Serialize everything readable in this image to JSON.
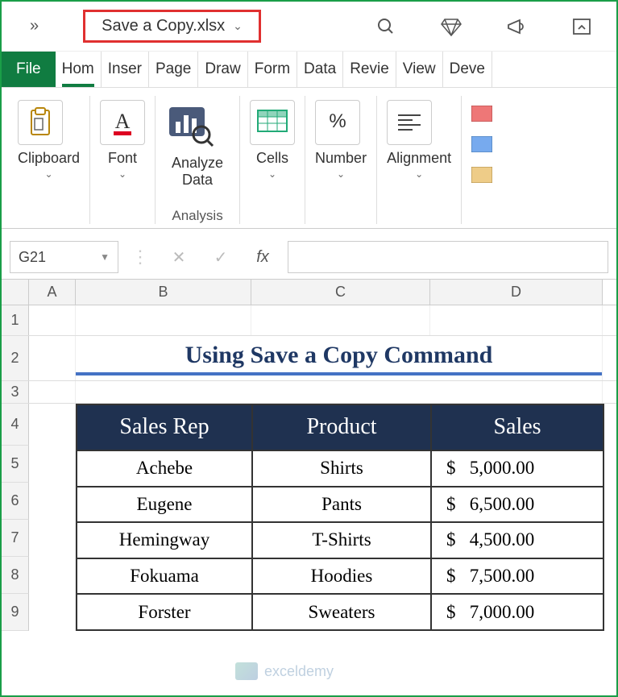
{
  "titlebar": {
    "filename": "Save a Copy.xlsx",
    "qat_more": "»"
  },
  "tabs": {
    "file": "File",
    "items": [
      "Hom",
      "Inser",
      "Page",
      "Draw",
      "Form",
      "Data",
      "Revie",
      "View",
      "Deve"
    ],
    "active": 0
  },
  "ribbon": {
    "clipboard": "Clipboard",
    "font": "Font",
    "analyze": "Analyze Data",
    "analysis_group": "Analysis",
    "cells": "Cells",
    "number": "Number",
    "alignment": "Alignment"
  },
  "formula_bar": {
    "namebox": "G21",
    "fx": "fx"
  },
  "columns": [
    "A",
    "B",
    "C",
    "D"
  ],
  "row_numbers": [
    "1",
    "2",
    "3",
    "4",
    "5",
    "6",
    "7",
    "8",
    "9"
  ],
  "sheet": {
    "title": "Using Save a Copy Command",
    "headers": [
      "Sales Rep",
      "Product",
      "Sales"
    ],
    "rows": [
      {
        "rep": "Achebe",
        "product": "Shirts",
        "sales": "$   5,000.00"
      },
      {
        "rep": "Eugene",
        "product": "Pants",
        "sales": "$   6,500.00"
      },
      {
        "rep": "Hemingway",
        "product": "T-Shirts",
        "sales": "$   4,500.00"
      },
      {
        "rep": "Fokuama",
        "product": "Hoodies",
        "sales": "$   7,500.00"
      },
      {
        "rep": "Forster",
        "product": "Sweaters",
        "sales": "$   7,000.00"
      }
    ]
  },
  "watermark": "exceldemy"
}
